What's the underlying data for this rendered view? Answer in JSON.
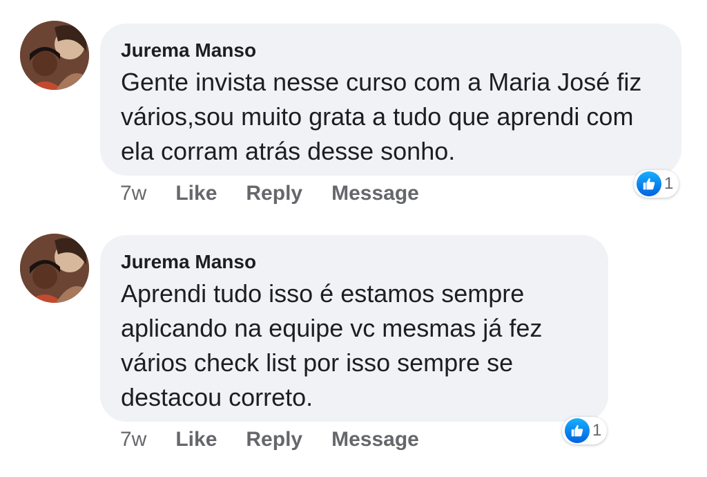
{
  "colors": {
    "bubble_bg": "#f0f2f5",
    "text": "#1c1e21",
    "secondary_text": "#65676b",
    "like_blue": "#1877f2"
  },
  "comments": [
    {
      "author": "Jurema Manso",
      "text": "Gente invista nesse curso com a Maria José fiz vários,sou muito grata a tudo que aprendi com ela corram atrás desse sonho.",
      "time": "7w",
      "like_label": "Like",
      "reply_label": "Reply",
      "message_label": "Message",
      "reaction_icon": "thumbs-up-icon",
      "reaction_count": "1"
    },
    {
      "author": "Jurema Manso",
      "text": "Aprendi tudo isso é estamos sempre aplicando na equipe vc mesmas já fez vários check list por isso sempre se destacou correto.",
      "time": "7w",
      "like_label": "Like",
      "reply_label": "Reply",
      "message_label": "Message",
      "reaction_icon": "thumbs-up-icon",
      "reaction_count": "1"
    }
  ]
}
